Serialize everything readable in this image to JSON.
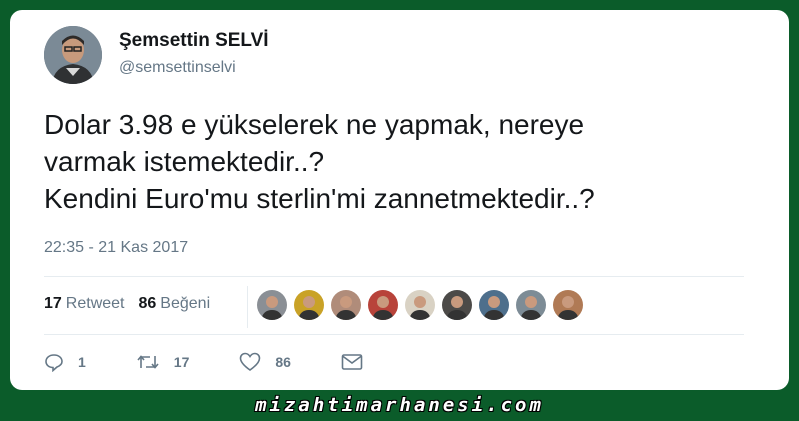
{
  "author": {
    "name": "Şemsettin SELVİ",
    "handle": "@semsettinselvi"
  },
  "tweet": {
    "lines": [
      "Dolar 3.98 e yükselerek ne yapmak, nereye",
      "varmak istemektedir..?",
      "Kendini Euro'mu sterlin'mi zannetmektedir..?"
    ],
    "timestamp": "22:35 - 21 Kas 2017"
  },
  "stats": {
    "retweet_count": "17",
    "retweet_label": "Retweet",
    "like_count": "86",
    "like_label": "Beğeni"
  },
  "liker_colors": [
    "#8a8f95",
    "#c9a227",
    "#b08c7a",
    "#b8433a",
    "#d9d2c4",
    "#4c4a48",
    "#4e6f8c",
    "#7d8c96",
    "#b07a55"
  ],
  "actions": {
    "reply_count": "1",
    "retweet_count": "17",
    "like_count": "86"
  },
  "watermark": "mizahtimarhanesi.com"
}
